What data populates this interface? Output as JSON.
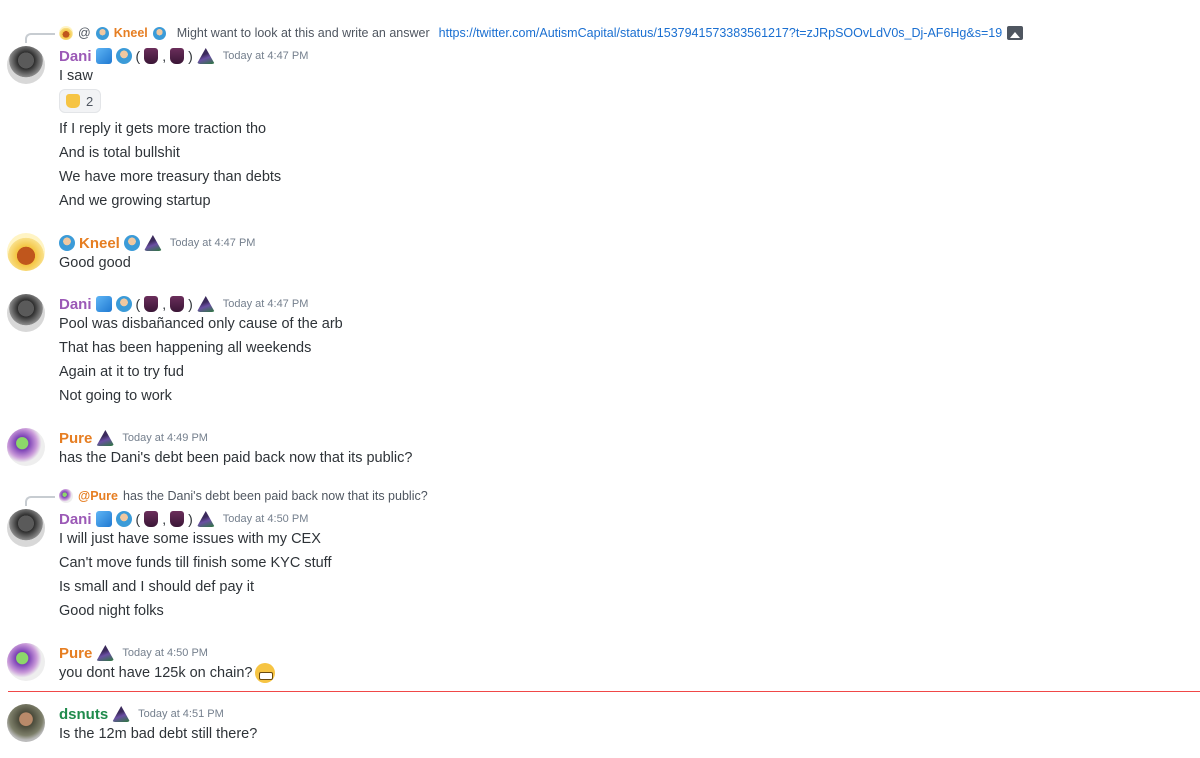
{
  "messages": [
    {
      "id": "m1",
      "author": "Dani",
      "timestamp": "Today at 4:47 PM",
      "reply": {
        "prefix": "@",
        "name": "Kneel",
        "text": "Might want to look at this and write an answer",
        "link": "https://twitter.com/AutismCapital/status/1537941573383561217?t=zJRpSOOvLdV0s_Dj-AF6Hg&s=19"
      },
      "lines": [
        "I saw"
      ],
      "reaction": {
        "emoji": "thumbs-up",
        "count": "2"
      },
      "lines_after": [
        "If I reply it gets more traction tho",
        "And is total bullshit",
        "We have more treasury than debts",
        "And we growing startup"
      ]
    },
    {
      "id": "m2",
      "author": "Kneel",
      "timestamp": "Today at 4:47 PM",
      "lines": [
        "Good good"
      ]
    },
    {
      "id": "m3",
      "author": "Dani",
      "timestamp": "Today at 4:47 PM",
      "lines": [
        "Pool was disbañanced only cause of the arb",
        "That has been happening all weekends",
        "Again at it to try fud",
        "Not going to work"
      ]
    },
    {
      "id": "m4",
      "author": "Pure",
      "timestamp": "Today at 4:49 PM",
      "lines": [
        "has the Dani's debt been paid back now that its public?"
      ]
    },
    {
      "id": "m5",
      "author": "Dani",
      "timestamp": "Today at 4:50 PM",
      "reply": {
        "prefix": "@",
        "name": "Pure",
        "text": "has the Dani's debt been paid back now that its public?"
      },
      "lines": [
        "I will just have some issues with my CEX",
        "Can't move funds till finish some KYC stuff",
        "Is small and I should def pay it",
        "Good night folks"
      ]
    },
    {
      "id": "m6",
      "author": "Pure",
      "timestamp": "Today at 4:50 PM",
      "lines": [
        "you dont have 125k on chain?"
      ],
      "trailing_emoji": "grimacing-face"
    },
    {
      "id": "m7",
      "author": "dsnuts",
      "timestamp": "Today at 4:51 PM",
      "lines": [
        "Is the 12m bad debt still there?"
      ]
    }
  ],
  "colors": {
    "dani": "#9b59b6",
    "kneel": "#e67e22",
    "pure": "#e67e22",
    "dsnuts": "#1f8b4c",
    "new_divider": "#f04747",
    "link": "#1a6fd1"
  }
}
